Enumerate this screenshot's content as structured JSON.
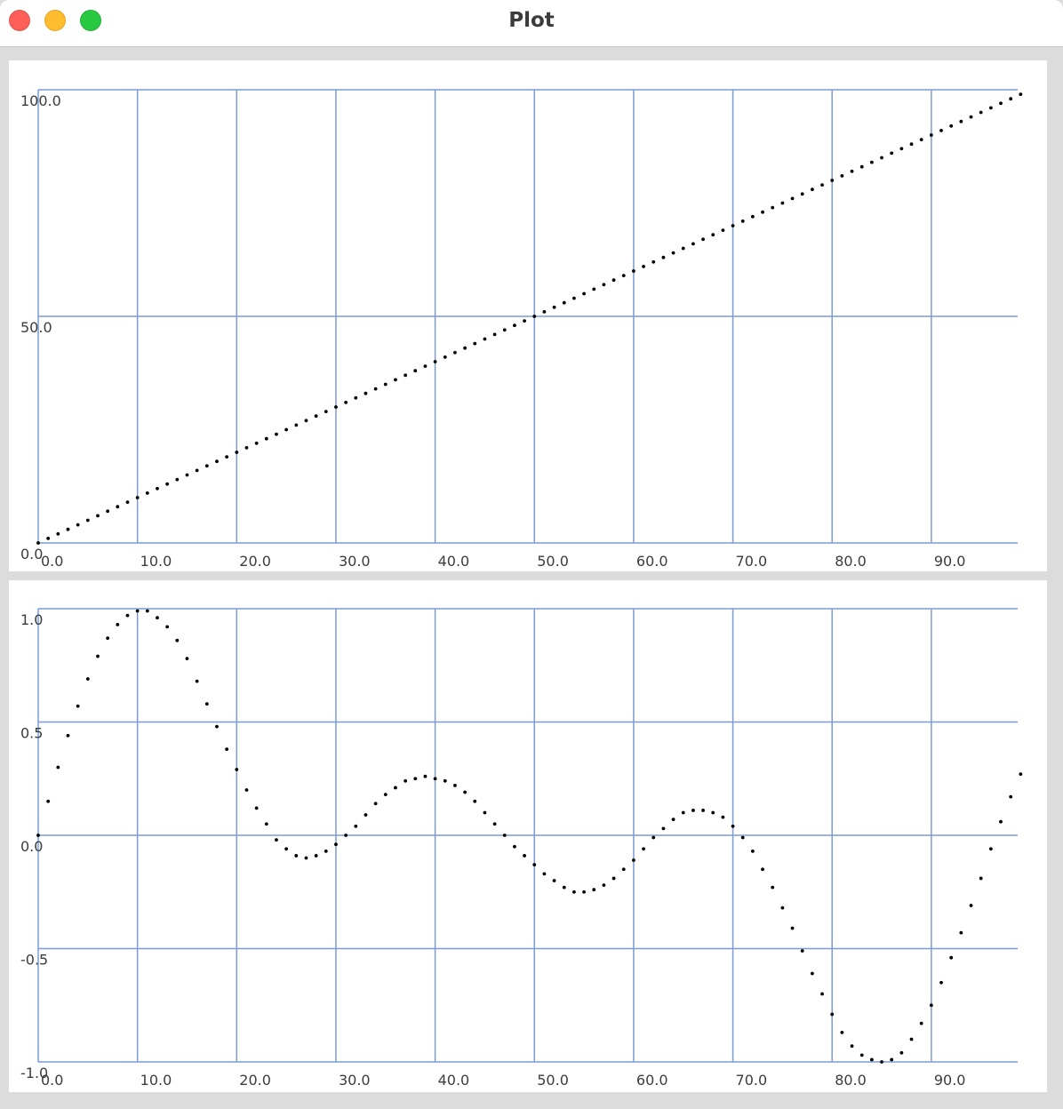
{
  "window": {
    "title": "Plot",
    "buttons": [
      "close",
      "minimize",
      "maximize"
    ],
    "colors": {
      "close": "#fe5f57",
      "minimize": "#febc2e",
      "maximize": "#28c840"
    }
  },
  "chart_data": [
    {
      "type": "scatter",
      "title": "",
      "xlabel": "",
      "ylabel": "",
      "xlim": [
        0,
        98.7
      ],
      "ylim": [
        0,
        100
      ],
      "grid": true,
      "grid_color": "#7b9bd6",
      "marker_color": "#000000",
      "x_ticks": [
        0,
        10,
        20,
        30,
        40,
        50,
        60,
        70,
        80,
        90
      ],
      "x_tick_labels": [
        "0.0",
        "10.0",
        "20.0",
        "30.0",
        "40.0",
        "50.0",
        "60.0",
        "70.0",
        "80.0",
        "90.0"
      ],
      "y_ticks": [
        0,
        50,
        100
      ],
      "y_tick_labels": [
        "0.0",
        "50.0",
        "100.0"
      ],
      "series": [
        {
          "x": [
            0,
            1,
            2,
            3,
            4,
            5,
            6,
            7,
            8,
            9,
            10,
            11,
            12,
            13,
            14,
            15,
            16,
            17,
            18,
            19,
            20,
            21,
            22,
            23,
            24,
            25,
            26,
            27,
            28,
            29,
            30,
            31,
            32,
            33,
            34,
            35,
            36,
            37,
            38,
            39,
            40,
            41,
            42,
            43,
            44,
            45,
            46,
            47,
            48,
            49,
            50,
            51,
            52,
            53,
            54,
            55,
            56,
            57,
            58,
            59,
            60,
            61,
            62,
            63,
            64,
            65,
            66,
            67,
            68,
            69,
            70,
            71,
            72,
            73,
            74,
            75,
            76,
            77,
            78,
            79,
            80,
            81,
            82,
            83,
            84,
            85,
            86,
            87,
            88,
            89,
            90,
            91,
            92,
            93,
            94,
            95,
            96,
            97,
            98,
            99
          ],
          "y": [
            0,
            1,
            2,
            3,
            4,
            5,
            6,
            7,
            8,
            9,
            10,
            11,
            12,
            13,
            14,
            15,
            16,
            17,
            18,
            19,
            20,
            21,
            22,
            23,
            24,
            25,
            26,
            27,
            28,
            29,
            30,
            31,
            32,
            33,
            34,
            35,
            36,
            37,
            38,
            39,
            40,
            41,
            42,
            43,
            44,
            45,
            46,
            47,
            48,
            49,
            50,
            51,
            52,
            53,
            54,
            55,
            56,
            57,
            58,
            59,
            60,
            61,
            62,
            63,
            64,
            65,
            66,
            67,
            68,
            69,
            70,
            71,
            72,
            73,
            74,
            75,
            76,
            77,
            78,
            79,
            80,
            81,
            82,
            83,
            84,
            85,
            86,
            87,
            88,
            89,
            90,
            91,
            92,
            93,
            94,
            95,
            96,
            97,
            98,
            99
          ]
        }
      ]
    },
    {
      "type": "scatter",
      "title": "",
      "xlabel": "",
      "ylabel": "",
      "xlim": [
        0,
        98.7
      ],
      "ylim": [
        -1,
        1
      ],
      "grid": true,
      "grid_color": "#7b9bd6",
      "marker_color": "#000000",
      "x_ticks": [
        0,
        10,
        20,
        30,
        40,
        50,
        60,
        70,
        80,
        90
      ],
      "x_tick_labels": [
        "0.0",
        "10.0",
        "20.0",
        "30.0",
        "40.0",
        "50.0",
        "60.0",
        "70.0",
        "80.0",
        "90.0"
      ],
      "y_ticks": [
        -1,
        -0.5,
        0,
        0.5,
        1
      ],
      "y_tick_labels": [
        "-1.0",
        "-0.5",
        "0.0",
        "0.5",
        "1.0"
      ],
      "series": [
        {
          "x": [
            0,
            1,
            2,
            3,
            4,
            5,
            6,
            7,
            8,
            9,
            10,
            11,
            12,
            13,
            14,
            15,
            16,
            17,
            18,
            19,
            20,
            21,
            22,
            23,
            24,
            25,
            26,
            27,
            28,
            29,
            30,
            31,
            32,
            33,
            34,
            35,
            36,
            37,
            38,
            39,
            40,
            41,
            42,
            43,
            44,
            45,
            46,
            47,
            48,
            49,
            50,
            51,
            52,
            53,
            54,
            55,
            56,
            57,
            58,
            59,
            60,
            61,
            62,
            63,
            64,
            65,
            66,
            67,
            68,
            69,
            70,
            71,
            72,
            73,
            74,
            75,
            76,
            77,
            78,
            79,
            80,
            81,
            82,
            83,
            84,
            85,
            86,
            87,
            88,
            89,
            90,
            91,
            92,
            93,
            94,
            95,
            96,
            97,
            98,
            99
          ],
          "y": [
            0.0,
            0.15,
            0.3,
            0.44,
            0.57,
            0.69,
            0.79,
            0.87,
            0.93,
            0.97,
            0.99,
            0.99,
            0.96,
            0.92,
            0.86,
            0.78,
            0.68,
            0.58,
            0.48,
            0.38,
            0.29,
            0.2,
            0.12,
            0.05,
            -0.02,
            -0.06,
            -0.09,
            -0.1,
            -0.09,
            -0.07,
            -0.04,
            0.0,
            0.04,
            0.09,
            0.14,
            0.18,
            0.21,
            0.24,
            0.25,
            0.26,
            0.25,
            0.24,
            0.22,
            0.19,
            0.15,
            0.1,
            0.05,
            0.0,
            -0.05,
            -0.09,
            -0.13,
            -0.17,
            -0.2,
            -0.23,
            -0.25,
            -0.25,
            -0.24,
            -0.22,
            -0.19,
            -0.15,
            -0.11,
            -0.06,
            -0.01,
            0.03,
            0.07,
            0.1,
            0.11,
            0.11,
            0.1,
            0.08,
            0.04,
            -0.01,
            -0.07,
            -0.15,
            -0.23,
            -0.32,
            -0.41,
            -0.51,
            -0.61,
            -0.7,
            -0.79,
            -0.87,
            -0.93,
            -0.97,
            -0.99,
            -1.0,
            -0.99,
            -0.96,
            -0.9,
            -0.83,
            -0.75,
            -0.65,
            -0.54,
            -0.43,
            -0.31,
            -0.19,
            -0.06,
            0.06,
            0.17,
            0.27
          ]
        }
      ]
    }
  ]
}
